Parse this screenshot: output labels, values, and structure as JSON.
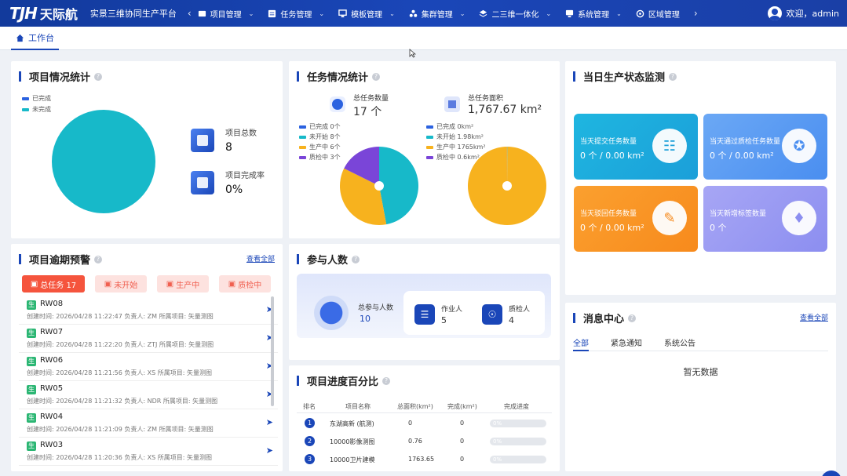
{
  "header": {
    "logo_mark": "TJH",
    "logo_text": "天际航",
    "platform": "实景三维协同生产平台",
    "nav_prev": "‹",
    "nav_next": "›",
    "nav": [
      {
        "label": "项目管理",
        "icon": "folder-icon"
      },
      {
        "label": "任务管理",
        "icon": "task-icon"
      },
      {
        "label": "模板管理",
        "icon": "template-icon"
      },
      {
        "label": "集群管理",
        "icon": "cluster-icon"
      },
      {
        "label": "二三维一体化",
        "icon": "3d-icon"
      },
      {
        "label": "系统管理",
        "icon": "monitor-icon"
      },
      {
        "label": "区域管理",
        "icon": "region-icon"
      }
    ],
    "user": "欢迎，admin"
  },
  "tabs": {
    "active": "工作台"
  },
  "project_stats": {
    "title": "项目情况统计",
    "legend": [
      "已完成",
      "未完成"
    ],
    "total_label": "项目总数",
    "total_value": "8",
    "rate_label": "项目完成率",
    "rate_value": "0%",
    "colors": {
      "done": "#2b62e0",
      "undone": "#17b9c9"
    }
  },
  "task_stats": {
    "title": "任务情况统计",
    "count_label": "总任务数量",
    "count_value": "17 个",
    "area_label": "总任务面积",
    "area_value": "1,767.67 km²",
    "count_legend": [
      "已完成 0个",
      "未开始 8个",
      "生产中 6个",
      "质检中 3个"
    ],
    "area_legend": [
      "已完成 0km²",
      "未开始 1.98km²",
      "生产中 1765km²",
      "质检中 0.6km²"
    ],
    "count_slices": [
      0,
      8,
      6,
      3
    ],
    "area_slices": [
      0,
      1.98,
      1765,
      0.6
    ],
    "colors": [
      "#2b62e0",
      "#17b9c9",
      "#f7b21e",
      "#7a45d8"
    ]
  },
  "monitor": {
    "title": "当日生产状态监测",
    "cards": [
      {
        "label": "当天提交任务数量",
        "value": "0 个 / 0.00 km²",
        "icon": "clipboard-icon"
      },
      {
        "label": "当天通过质检任务数量",
        "value": "0 个 / 0.00 km²",
        "icon": "medal-icon"
      },
      {
        "label": "当天驳回任务数量",
        "value": "0 个 / 0.00 km²",
        "icon": "reject-doc-icon"
      },
      {
        "label": "当天新增标签数量",
        "value": "0 个",
        "icon": "tag-icon"
      }
    ]
  },
  "overdue": {
    "title": "项目逾期预警",
    "more": "查看全部",
    "filters": [
      "总任务 17",
      "未开始",
      "生产中",
      "质检中"
    ],
    "badge": "生",
    "rows": [
      {
        "name": "RW08",
        "meta": "创建时间:  2026/04/28 11:22:47   负责人:  ZM   所属项目:  矢量测图"
      },
      {
        "name": "RW07",
        "meta": "创建时间:  2026/04/28 11:22:20   负责人:  ZTJ   所属项目:  矢量测图"
      },
      {
        "name": "RW06",
        "meta": "创建时间:  2026/04/28 11:21:56   负责人:  XS   所属项目:  矢量测图"
      },
      {
        "name": "RW05",
        "meta": "创建时间:  2026/04/28 11:21:32   负责人:  NDR   所属项目:  矢量测图"
      },
      {
        "name": "RW04",
        "meta": "创建时间:  2026/04/28 11:21:09   负责人:  ZM   所属项目:  矢量测图"
      },
      {
        "name": "RW03",
        "meta": "创建时间:  2026/04/28 11:20:36   负责人:  XS   所属项目:  矢量测图"
      }
    ]
  },
  "participants": {
    "title": "参与人数",
    "total_label": "总参与人数",
    "total_value": "10",
    "worker_label": "作业人",
    "worker_value": "5",
    "qc_label": "质检人",
    "qc_value": "4"
  },
  "progress": {
    "title": "项目进度百分比",
    "headers": [
      "排名",
      "项目名称",
      "总面积(km²)",
      "完成(km²)",
      "完成进度"
    ],
    "rows": [
      {
        "rank": "1",
        "name": "东湖高新 (航测)",
        "total": "0",
        "done": "0",
        "pct": "0%"
      },
      {
        "rank": "2",
        "name": "10000影像测图",
        "total": "0.76",
        "done": "0",
        "pct": "0%"
      },
      {
        "rank": "3",
        "name": "10000卫片建模",
        "total": "1763.65",
        "done": "0",
        "pct": "0%"
      }
    ]
  },
  "messages": {
    "title": "消息中心",
    "more": "查看全部",
    "tabs": [
      "全部",
      "紧急通知",
      "系统公告"
    ],
    "empty": "暂无数据"
  }
}
